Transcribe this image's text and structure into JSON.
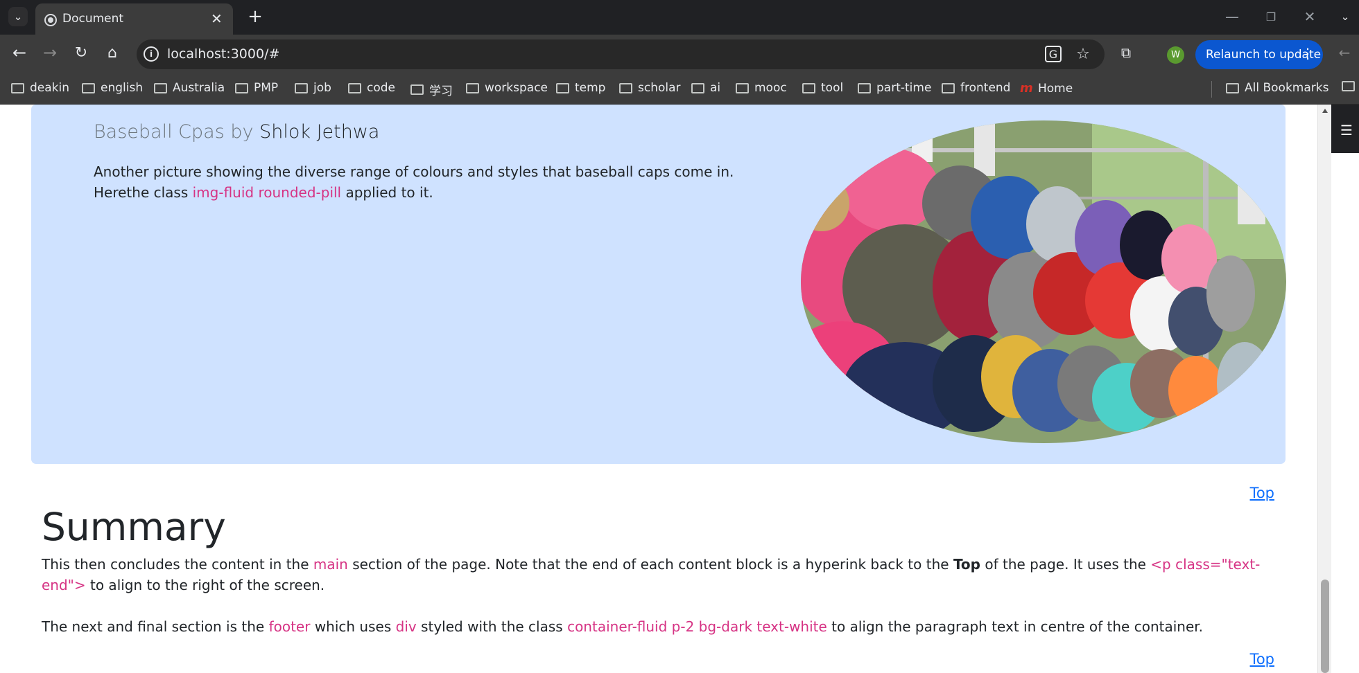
{
  "browser": {
    "tab_title": "Document",
    "url": "localhost:3000/#",
    "relaunch_label": "Relaunch to update",
    "profile_initial": "W",
    "bookmarks": [
      "deakin",
      "english",
      "Australia",
      "PMP",
      "job",
      "code",
      "学习",
      "workspace",
      "temp",
      "scholar",
      "ai",
      "mooc",
      "tool",
      "part-time",
      "frontend",
      "Home"
    ],
    "all_bookmarks": "All Bookmarks"
  },
  "card": {
    "title_prefix": "Baseball Cpas by",
    "author": "Shlok Jethwa",
    "text_1": "Another picture showing the diverse range of colours and styles that baseball caps come in. Herethe class",
    "class_name": "img-fluid rounded-pill",
    "text_2": "applied to it."
  },
  "top_link": "Top",
  "summary": {
    "heading": "Summary",
    "p1_a": "This then concludes the content in the",
    "p1_main": "main",
    "p1_b": "section of the page. Note that the end of each content block is a hyperink back to the",
    "p1_top": "Top",
    "p1_c": "of the page. It uses the",
    "p1_code": "<p class=\"text-end\">",
    "p1_d": "to align to the right of the screen.",
    "p2_a": "The next and final section is the",
    "p2_footer": "footer",
    "p2_b": "which uses",
    "p2_div": "div",
    "p2_c": "styled with the class",
    "p2_class": "container-fluid p-2 bg-dark text-white",
    "p2_d": "to align the paragraph text in centre of the container."
  },
  "colors": {
    "card_bg": "#cfe2ff",
    "code_red": "#d63384",
    "link_blue": "#0d6efd",
    "relaunch_blue": "#0b57d0"
  }
}
